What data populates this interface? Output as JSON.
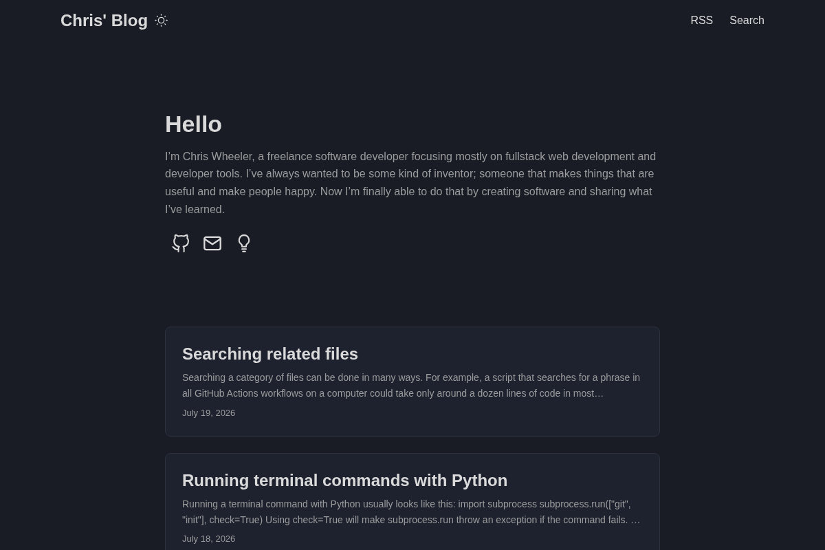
{
  "header": {
    "title": "Chris' Blog",
    "nav": [
      "RSS",
      "Search"
    ]
  },
  "intro": {
    "heading": "Hello",
    "text": "I’m Chris Wheeler, a freelance software developer focusing mostly on fullstack web development and developer tools. I’ve always wanted to be some kind of inventor; someone that makes things that are useful and make people happy. Now I’m finally able to do that by creating software and sharing what I’ve learned."
  },
  "posts": [
    {
      "title": "Searching related files",
      "summary": "Searching a category of files can be done in many ways. For example, a script that searches for a phrase in all GitHub Actions workflows on a computer could take only around a dozen lines of code in most…",
      "date": "July 19, 2026"
    },
    {
      "title": "Running terminal commands with Python",
      "summary": "Running a terminal command with Python usually looks like this: import subprocess subprocess.run([\"git\", \"init\"], check=True) Using check=True will make subprocess.run throw an exception if the command fails. …",
      "date": "July 18, 2026"
    }
  ]
}
